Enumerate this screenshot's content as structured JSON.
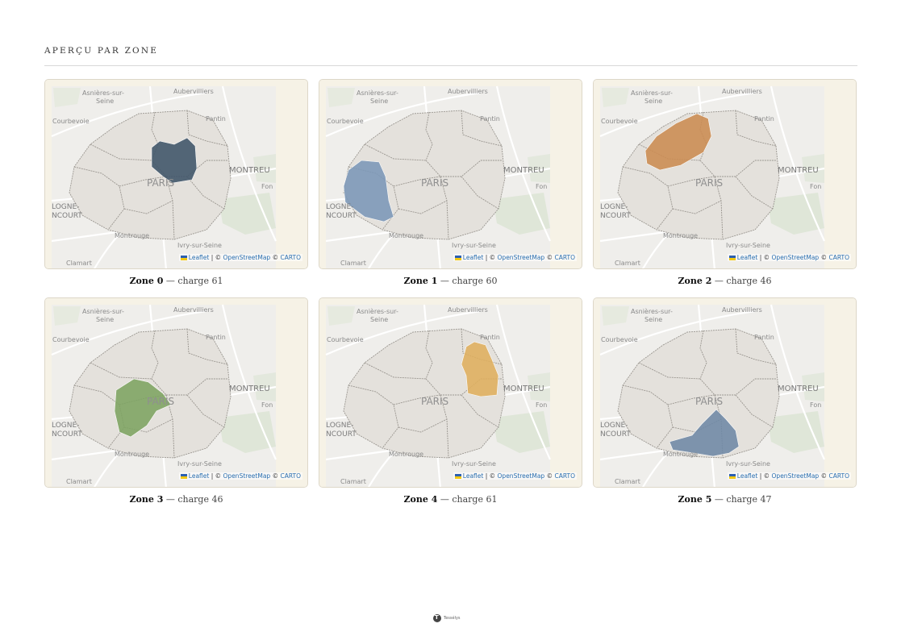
{
  "page": {
    "title": "APERÇU PAR ZONE"
  },
  "map_labels": {
    "asnieres_1": "Asnières-sur-",
    "asnieres_2": "Seine",
    "aubervilliers": "Aubervilliers",
    "courbevoie": "Courbevoie",
    "pantin": "Pantin",
    "montreuil": "MONTREU",
    "fon": "Fon",
    "paris": "PARIS",
    "boulogne_1": "LOGNE-",
    "boulogne_2": "NCOURT",
    "montrouge": "Montrouge",
    "ivry": "Ivry-sur-Seine",
    "clamart": "Clamart"
  },
  "attribution": {
    "leaflet": "Leaflet",
    "sep": "| ©",
    "osm": "OpenStreetMap",
    "copy": "©",
    "carto": "CARTO"
  },
  "zones": [
    {
      "label": "Zone 0",
      "sep": "—",
      "charge_text": "charge 61",
      "charge": 61,
      "color": "#3f5569"
    },
    {
      "label": "Zone 1",
      "sep": "—",
      "charge_text": "charge 60",
      "charge": 60,
      "color": "#7c98b8"
    },
    {
      "label": "Zone 2",
      "sep": "—",
      "charge_text": "charge 46",
      "charge": 46,
      "color": "#cc8c52"
    },
    {
      "label": "Zone 3",
      "sep": "—",
      "charge_text": "charge 46",
      "charge": 46,
      "color": "#7ea462"
    },
    {
      "label": "Zone 4",
      "sep": "—",
      "charge_text": "charge 61",
      "charge": 61,
      "color": "#e0b05e"
    },
    {
      "label": "Zone 5",
      "sep": "—",
      "charge_text": "charge 47",
      "charge": 47,
      "color": "#6f89a6"
    }
  ],
  "footer": {
    "brand": "Tessélys"
  },
  "icons": {
    "footer_logo": "brand-logo-icon",
    "attribution_flag": "ukraine-flag-icon"
  }
}
